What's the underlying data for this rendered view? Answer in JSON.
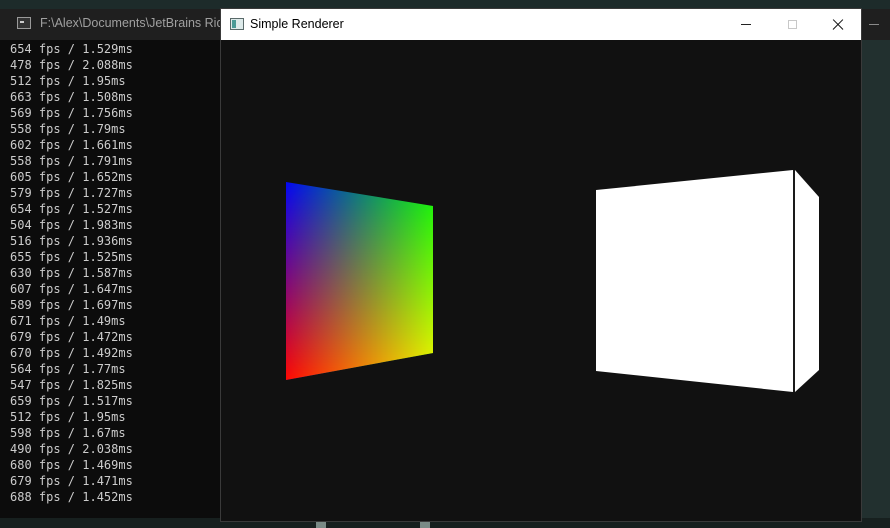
{
  "console": {
    "title": "F:\\Alex\\Documents\\JetBrains Ride",
    "lines": [
      "654 fps / 1.529ms",
      "478 fps / 2.088ms",
      "512 fps / 1.95ms",
      "663 fps / 1.508ms",
      "569 fps / 1.756ms",
      "558 fps / 1.79ms",
      "602 fps / 1.661ms",
      "558 fps / 1.791ms",
      "605 fps / 1.652ms",
      "579 fps / 1.727ms",
      "654 fps / 1.527ms",
      "504 fps / 1.983ms",
      "516 fps / 1.936ms",
      "655 fps / 1.525ms",
      "630 fps / 1.587ms",
      "607 fps / 1.647ms",
      "589 fps / 1.697ms",
      "671 fps / 1.49ms",
      "679 fps / 1.472ms",
      "670 fps / 1.492ms",
      "564 fps / 1.77ms",
      "547 fps / 1.825ms",
      "659 fps / 1.517ms",
      "512 fps / 1.95ms",
      "598 fps / 1.67ms",
      "490 fps / 2.038ms",
      "680 fps / 1.469ms",
      "679 fps / 1.471ms",
      "688 fps / 1.452ms"
    ]
  },
  "renderer": {
    "title": "Simple Renderer",
    "icons": {
      "app": "window-icon",
      "minimize": "minimize-icon",
      "maximize": "maximize-icon",
      "close": "close-icon"
    },
    "colors": {
      "viewport_background": "#111111",
      "quad_corners": [
        "#0000ff",
        "#00ff00",
        "#ffff00",
        "#ff0000"
      ],
      "cube_face": "#ffffff"
    }
  }
}
